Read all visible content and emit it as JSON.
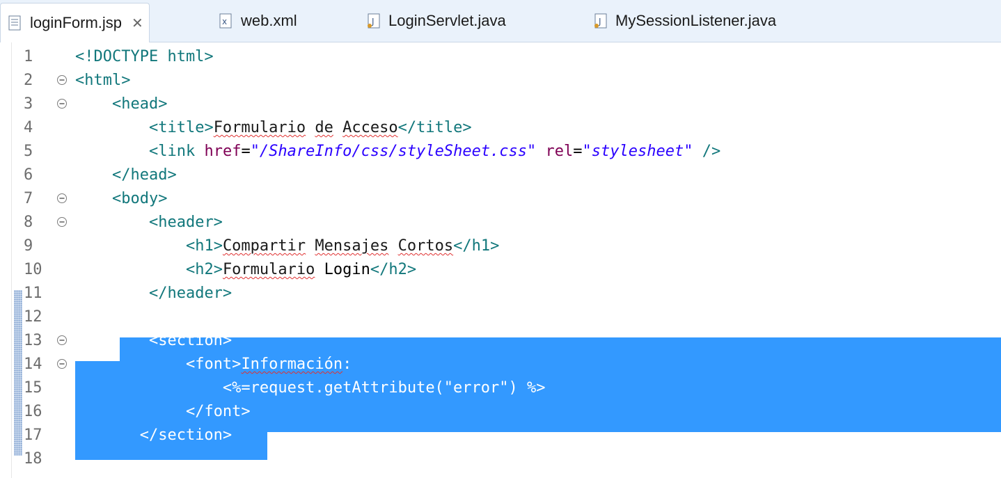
{
  "tabs": [
    {
      "label": "loginForm.jsp",
      "icon": "jsp-file-icon",
      "active": true,
      "close": "✕"
    },
    {
      "label": "web.xml",
      "icon": "xml-file-icon",
      "active": false
    },
    {
      "label": "LoginServlet.java",
      "icon": "java-file-icon",
      "active": false
    },
    {
      "label": "MySessionListener.java",
      "icon": "java-file-icon",
      "active": false
    }
  ],
  "lines": [
    {
      "n": "1",
      "fold": false,
      "parts": [
        [
          "ang",
          "<!DOCTYPE html>"
        ]
      ]
    },
    {
      "n": "2",
      "fold": true,
      "parts": [
        [
          "ang",
          "<html>"
        ]
      ]
    },
    {
      "n": "3",
      "fold": true,
      "parts": [
        [
          "txt",
          "    "
        ],
        [
          "ang",
          "<head>"
        ]
      ]
    },
    {
      "n": "4",
      "fold": false,
      "parts": [
        [
          "txt",
          "        "
        ],
        [
          "ang",
          "<title>"
        ],
        [
          "spell",
          "Formulario"
        ],
        [
          "txt",
          " "
        ],
        [
          "spell",
          "de"
        ],
        [
          "txt",
          " "
        ],
        [
          "spell",
          "Acceso"
        ],
        [
          "ang",
          "</title>"
        ]
      ]
    },
    {
      "n": "5",
      "fold": false,
      "parts": [
        [
          "txt",
          "        "
        ],
        [
          "ang",
          "<link "
        ],
        [
          "attr",
          "href"
        ],
        [
          "txt",
          "="
        ],
        [
          "str",
          "\"/ShareInfo/css/styleSheet.css\""
        ],
        [
          "txt",
          " "
        ],
        [
          "attr",
          "rel"
        ],
        [
          "txt",
          "="
        ],
        [
          "str",
          "\"stylesheet\""
        ],
        [
          "txt",
          " "
        ],
        [
          "ang",
          "/>"
        ]
      ]
    },
    {
      "n": "6",
      "fold": false,
      "parts": [
        [
          "txt",
          "    "
        ],
        [
          "ang",
          "</head>"
        ]
      ]
    },
    {
      "n": "7",
      "fold": true,
      "parts": [
        [
          "txt",
          "    "
        ],
        [
          "ang",
          "<body>"
        ]
      ]
    },
    {
      "n": "8",
      "fold": true,
      "parts": [
        [
          "txt",
          "        "
        ],
        [
          "ang",
          "<header>"
        ]
      ]
    },
    {
      "n": "9",
      "fold": false,
      "parts": [
        [
          "txt",
          "            "
        ],
        [
          "ang",
          "<h1>"
        ],
        [
          "spell",
          "Compartir"
        ],
        [
          "txt",
          " "
        ],
        [
          "spell",
          "Mensajes"
        ],
        [
          "txt",
          " "
        ],
        [
          "spell",
          "Cortos"
        ],
        [
          "ang",
          "</h1>"
        ]
      ]
    },
    {
      "n": "10",
      "fold": false,
      "parts": [
        [
          "txt",
          "            "
        ],
        [
          "ang",
          "<h2>"
        ],
        [
          "spell",
          "Formulario"
        ],
        [
          "txt",
          " Login"
        ],
        [
          "ang",
          "</h2>"
        ]
      ]
    },
    {
      "n": "11",
      "fold": false,
      "parts": [
        [
          "txt",
          "        "
        ],
        [
          "ang",
          "</header>"
        ]
      ]
    },
    {
      "n": "12",
      "fold": false,
      "parts": [
        [
          "txt",
          ""
        ]
      ]
    },
    {
      "n": "13",
      "fold": true,
      "parts": [
        [
          "txt",
          "        "
        ],
        [
          "ang",
          "<section>"
        ]
      ]
    },
    {
      "n": "14",
      "fold": true,
      "parts": [
        [
          "txt",
          "            "
        ],
        [
          "ang",
          "<font>"
        ],
        [
          "spell",
          "Información"
        ],
        [
          "txt",
          ":"
        ]
      ]
    },
    {
      "n": "15",
      "fold": false,
      "parts": [
        [
          "txt",
          "                <%=request.getAttribute(\"error\") %>"
        ]
      ]
    },
    {
      "n": "16",
      "fold": false,
      "parts": [
        [
          "txt",
          "            "
        ],
        [
          "ang",
          "</font>"
        ]
      ]
    },
    {
      "n": "17",
      "fold": false,
      "parts": [
        [
          "txt",
          "       "
        ],
        [
          "ang",
          "</section>"
        ]
      ]
    },
    {
      "n": "18",
      "fold": false,
      "parts": [
        [
          "txt",
          ""
        ]
      ]
    }
  ],
  "selection": {
    "from_line": 13,
    "to_line": 17
  },
  "colors": {
    "selection": "#3399ff",
    "tag": "#11777b",
    "attribute": "#7f0055",
    "string": "#2a00ff"
  }
}
